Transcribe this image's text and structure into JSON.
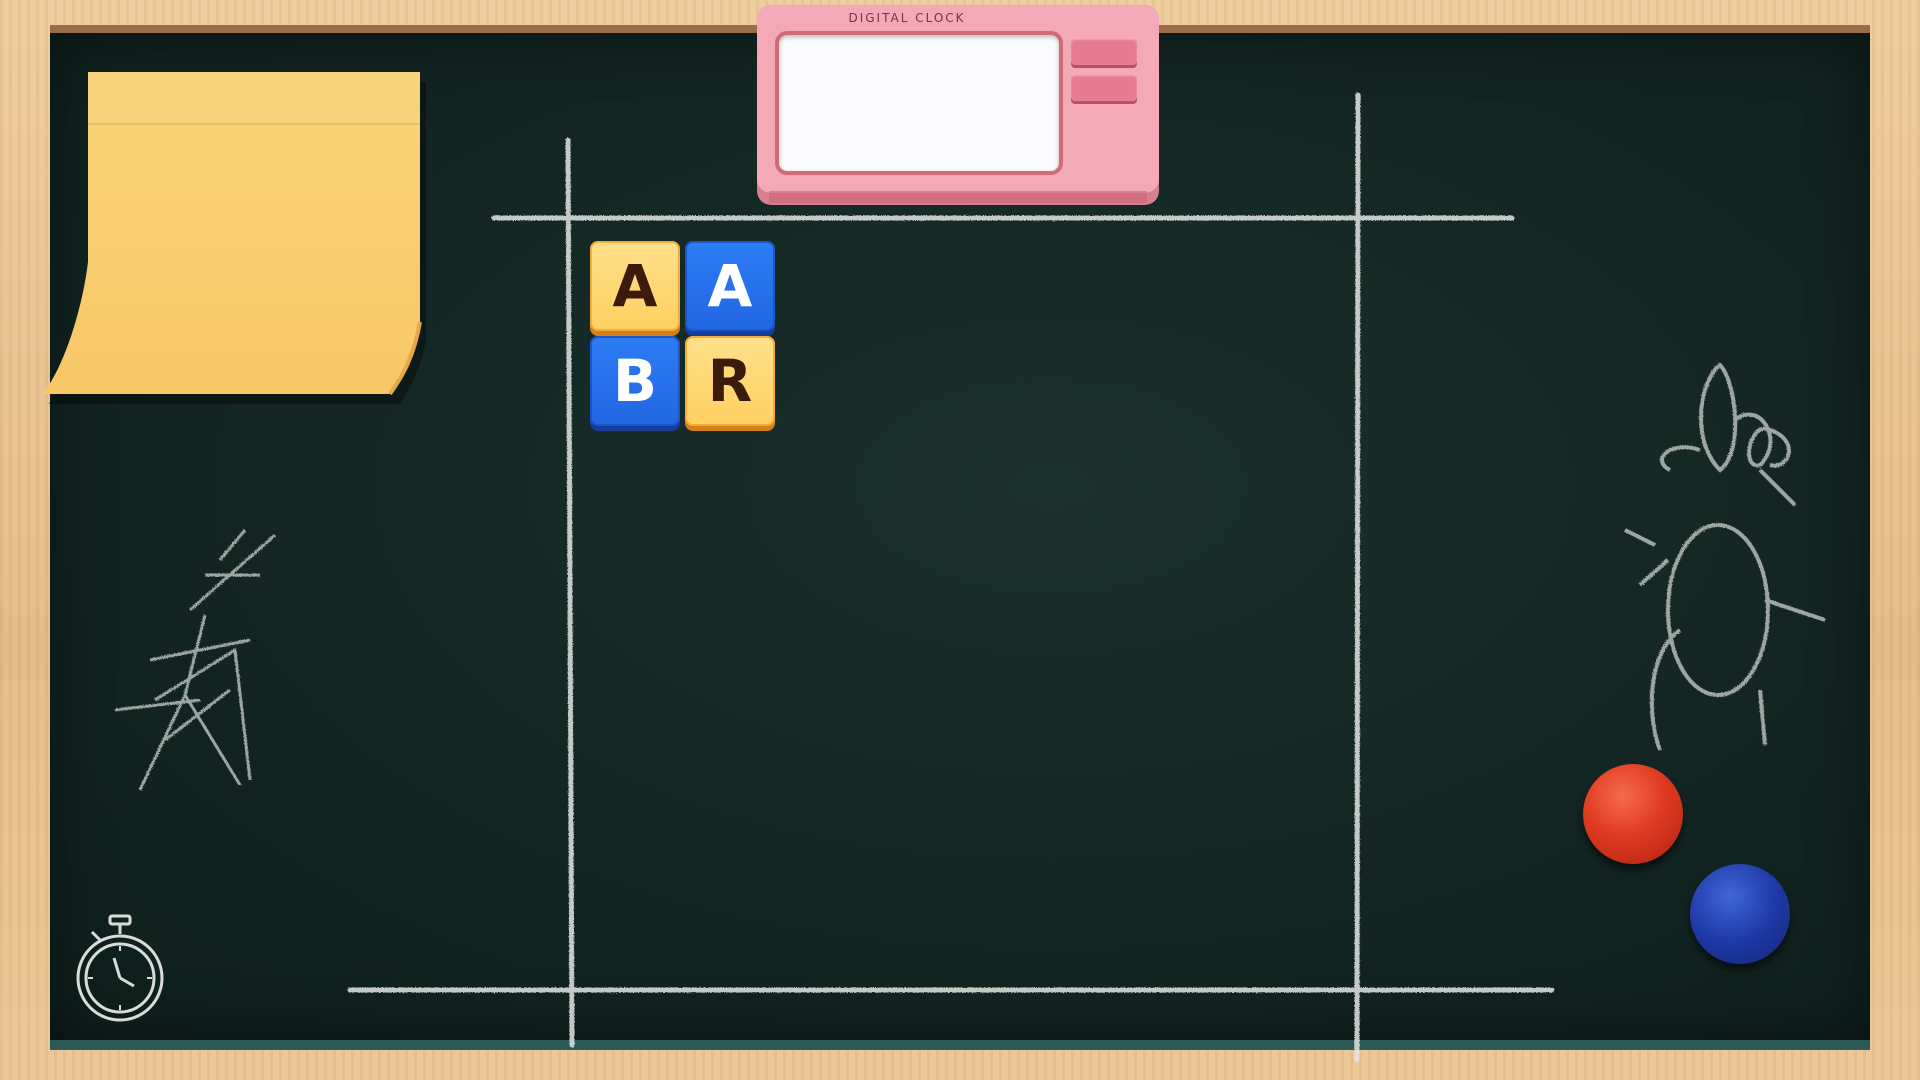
{
  "clock": {
    "label": "DIGITAL CLOCK",
    "display": ""
  },
  "tiles": [
    {
      "letter": "A",
      "color": "yellow"
    },
    {
      "letter": "A",
      "color": "blue"
    },
    {
      "letter": "B",
      "color": "blue"
    },
    {
      "letter": "R",
      "color": "yellow"
    }
  ],
  "sticky_note": {
    "text": "",
    "color": "#fbd57a"
  },
  "magnets": [
    {
      "color": "#de3b21",
      "name": "red"
    },
    {
      "color": "#1f3aa8",
      "name": "blue"
    }
  ],
  "colors": {
    "board": "#132623",
    "frame": "#e7c08f",
    "chalk": "#e9ecea",
    "tile_yellow": "#ffd061",
    "tile_blue": "#2166e3",
    "clock_body": "#f4a9b6"
  },
  "icons": [
    "stopwatch-icon"
  ]
}
